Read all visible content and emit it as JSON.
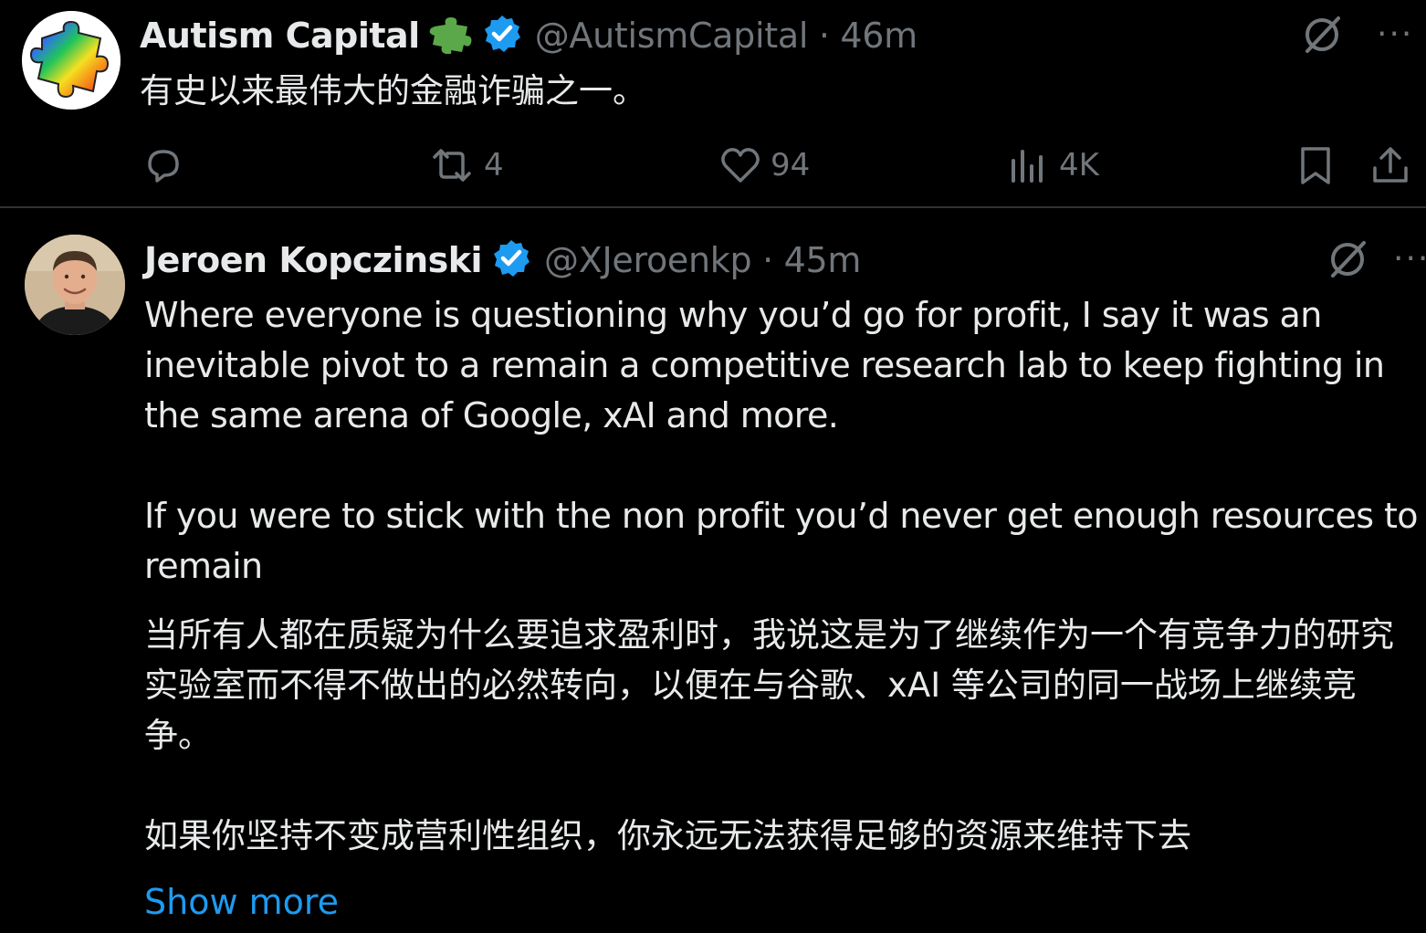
{
  "tweets": [
    {
      "author": "Autism Capital",
      "handle_time": "@AutismCapital · 46m",
      "text": "有史以来最伟大的金融诈骗之一。",
      "actions": {
        "reply_count": "",
        "retweet_count": "4",
        "like_count": "94",
        "views_count": "4K"
      },
      "more": "···"
    },
    {
      "author": "Jeroen Kopczinski",
      "handle_time": "@XJeroenkp · 45m",
      "paragraphs": [
        "Where everyone is questioning why you’d go for profit, I say it was an inevitable pivot to a remain a competitive research lab to keep fighting in the same arena of Google, xAI and more.",
        "If you were to stick with the non profit you’d never get enough resources to remain",
        "当所有人都在质疑为什么要追求盈利时，我说这是为了继续作为一个有竞争力的研究实验室而不得不做出的必然转向，以便在与谷歌、xAI 等公司的同一战场上继续竞争。",
        "如果你坚持不变成营利性组织，你永远无法获得足够的资源来维持下去"
      ],
      "show_more": "Show more",
      "more": "···"
    }
  ],
  "colors": {
    "background": "#000000",
    "text": "#e7e9ea",
    "secondary": "#71767b",
    "link": "#1d9bf0",
    "verified": "#1d9bf0",
    "divider": "#2f3336"
  },
  "icons": [
    "avatar-puzzle-icon",
    "puzzle-emoji-icon",
    "verified-badge-icon",
    "grok-icon",
    "more-icon",
    "reply-icon",
    "retweet-icon",
    "like-icon",
    "views-icon",
    "bookmark-icon",
    "share-icon"
  ]
}
